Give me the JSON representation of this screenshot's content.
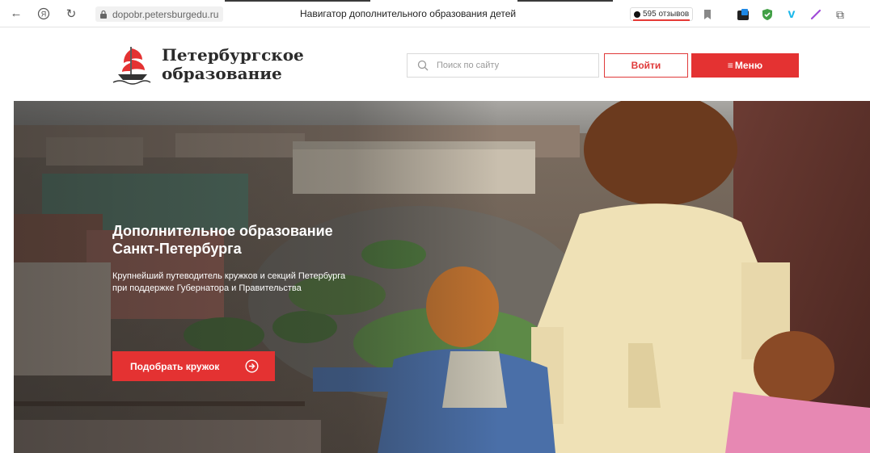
{
  "browser": {
    "url": "dopobr.petersburgedu.ru",
    "page_title": "Навигатор дополнительного образования детей",
    "reviews_label": "595 отзывов"
  },
  "header": {
    "logo_line1": "Петербургское",
    "logo_line2": "образование",
    "search_placeholder": "Поиск по сайту",
    "login_label": "Войти",
    "menu_label": "Меню"
  },
  "hero": {
    "title_line1": "Дополнительное образование",
    "title_line2": "Санкт-Петербурга",
    "subtitle_line1": "Крупнейший путеводитель кружков и секций Петербурга",
    "subtitle_line2": "при поддержке Губернатора и Правительства",
    "cta_label": "Подобрать кружок"
  },
  "colors": {
    "accent": "#e43232"
  },
  "icons": [
    "back-icon",
    "yandex-icon",
    "reload-icon",
    "lock-icon",
    "bookmark-icon",
    "extension-icon",
    "shield-icon",
    "vimeo-icon",
    "pen-icon",
    "puzzle-icon",
    "search-icon",
    "arrow-circle-icon"
  ]
}
